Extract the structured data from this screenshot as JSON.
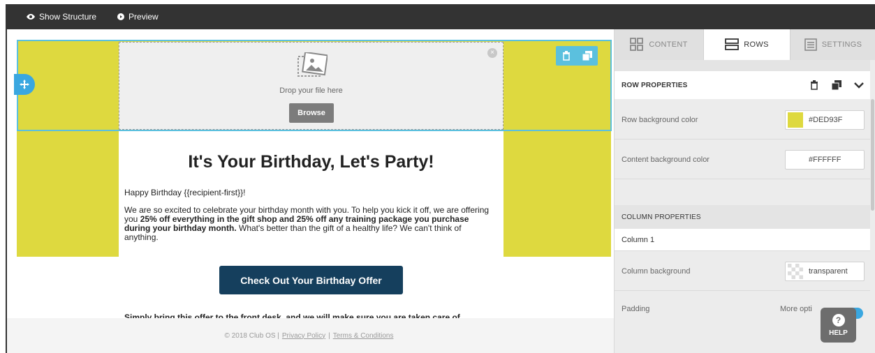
{
  "topbar": {
    "show_structure": "Show Structure",
    "preview": "Preview"
  },
  "canvas": {
    "row_color": "#DED93F",
    "drop_text": "Drop your file here",
    "browse_label": "Browse",
    "headline": "It's Your Birthday, Let's Party!",
    "greeting": "Happy Birthday {{recipient-first}}!",
    "para_1": "We are so excited to celebrate your birthday month with you. To help you kick it off, we are offering you ",
    "para_bold": "25% off everything in the gift shop and 25% off any training package you purchase during your birthday month.",
    "para_2": " What's better than the gift of a healthy life? We can't think of anything.",
    "cta_label": "Check Out Your Birthday Offer",
    "cutoff_text": "Simply bring this offer to the front desk, and we will make sure you are taken care of"
  },
  "footer": {
    "copyright": "© 2018 Club OS |",
    "privacy": "Privacy Policy",
    "separator": "|",
    "terms": "Terms & Conditions"
  },
  "panel": {
    "tabs": {
      "content": "CONTENT",
      "rows": "ROWS",
      "settings": "SETTINGS"
    },
    "row_properties": {
      "title": "ROW PROPERTIES",
      "row_bg_label": "Row background color",
      "row_bg_value": "#DED93F",
      "content_bg_label": "Content background color",
      "content_bg_value": "#FFFFFF"
    },
    "column_properties": {
      "title": "COLUMN PROPERTIES",
      "column_label": "Column 1",
      "column_bg_label": "Column background",
      "column_bg_value": "transparent",
      "padding_label": "Padding",
      "more_options": "More opti"
    }
  },
  "help": {
    "label": "HELP"
  },
  "colors": {
    "accent": "#5bc0de",
    "cta": "#153f5d",
    "row_bg": "#DED93F"
  }
}
